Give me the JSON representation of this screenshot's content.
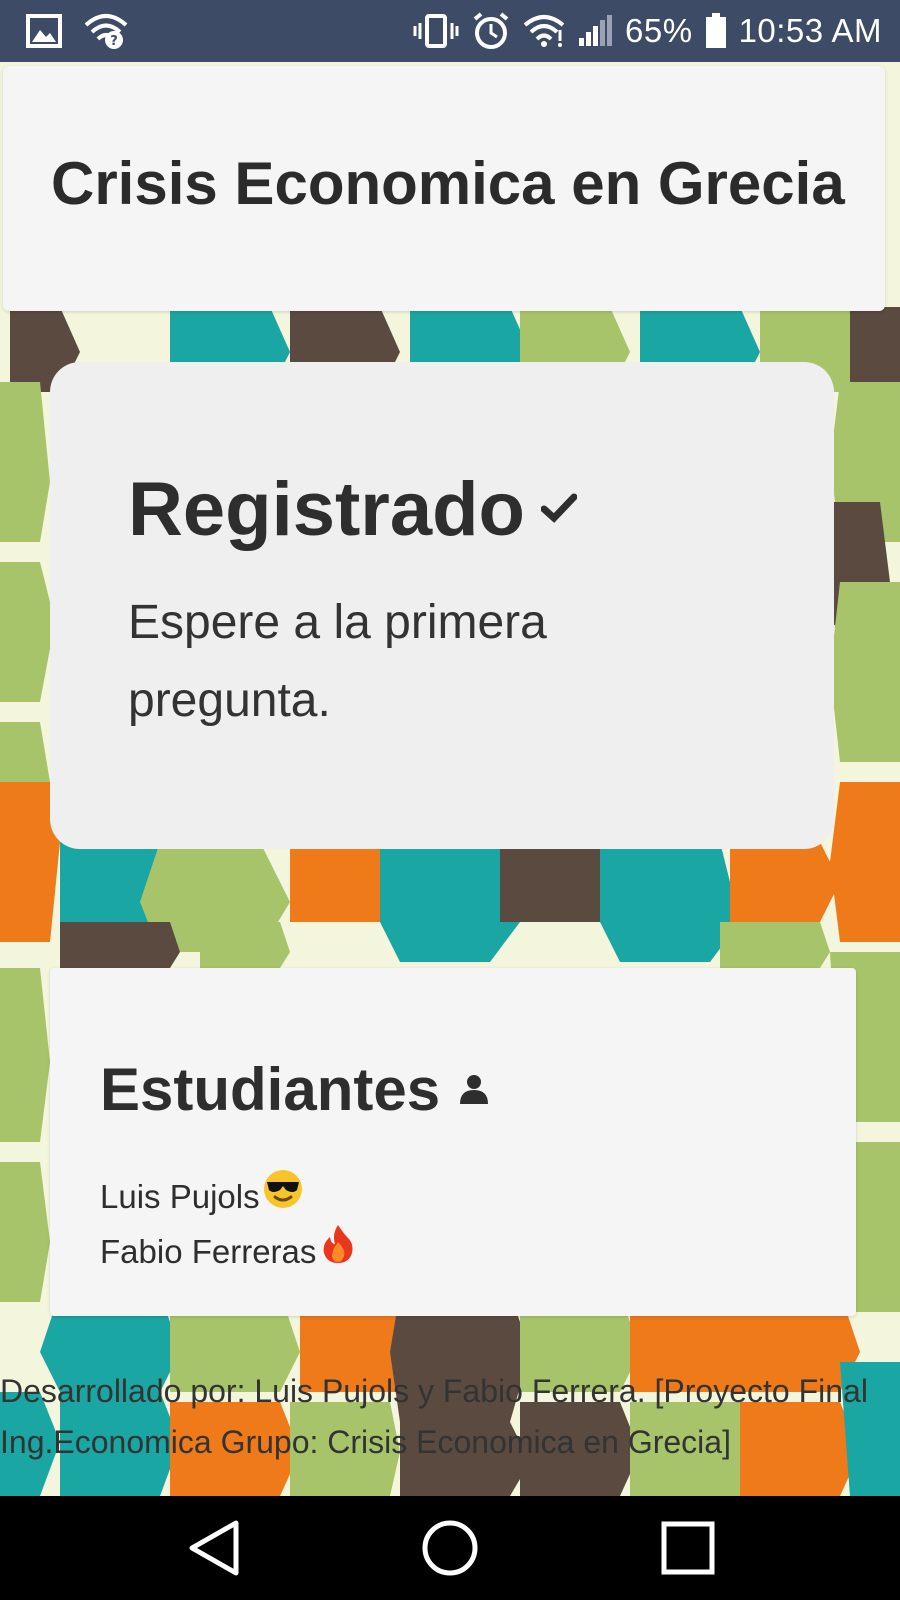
{
  "status_bar": {
    "battery": "65%",
    "time": "10:53 AM",
    "icons": [
      "image-icon",
      "wifi-question-icon",
      "vibrate-icon",
      "alarm-icon",
      "wifi-icon",
      "signal-icon",
      "battery-icon"
    ]
  },
  "header": {
    "title": "Crisis Economica en Grecia"
  },
  "panel": {
    "title": "Registrado",
    "title_icon": "checkmark-icon",
    "message": "Espere a la primera pregunta."
  },
  "students": {
    "title": "Estudiantes",
    "title_icon": "user-icon",
    "items": [
      {
        "name": "Luis Pujols",
        "emoji": "sunglasses-face-icon"
      },
      {
        "name": "Fabio Ferreras",
        "emoji": "fire-icon"
      }
    ]
  },
  "footer": {
    "text": "Desarrollado por: Luis Pujols y Fabio Ferrera. [Proyecto Final Ing.Economica Grupo: Crisis Economica en Grecia]"
  },
  "nav": {
    "buttons": [
      "back-icon",
      "home-icon",
      "recents-icon"
    ]
  },
  "colors": {
    "status_bar": "#3d4b66",
    "teal": "#1aa6a3",
    "green": "#a8c46a",
    "orange": "#ef7a1a",
    "brown": "#5a4a40",
    "cream": "#f3f6dc"
  }
}
